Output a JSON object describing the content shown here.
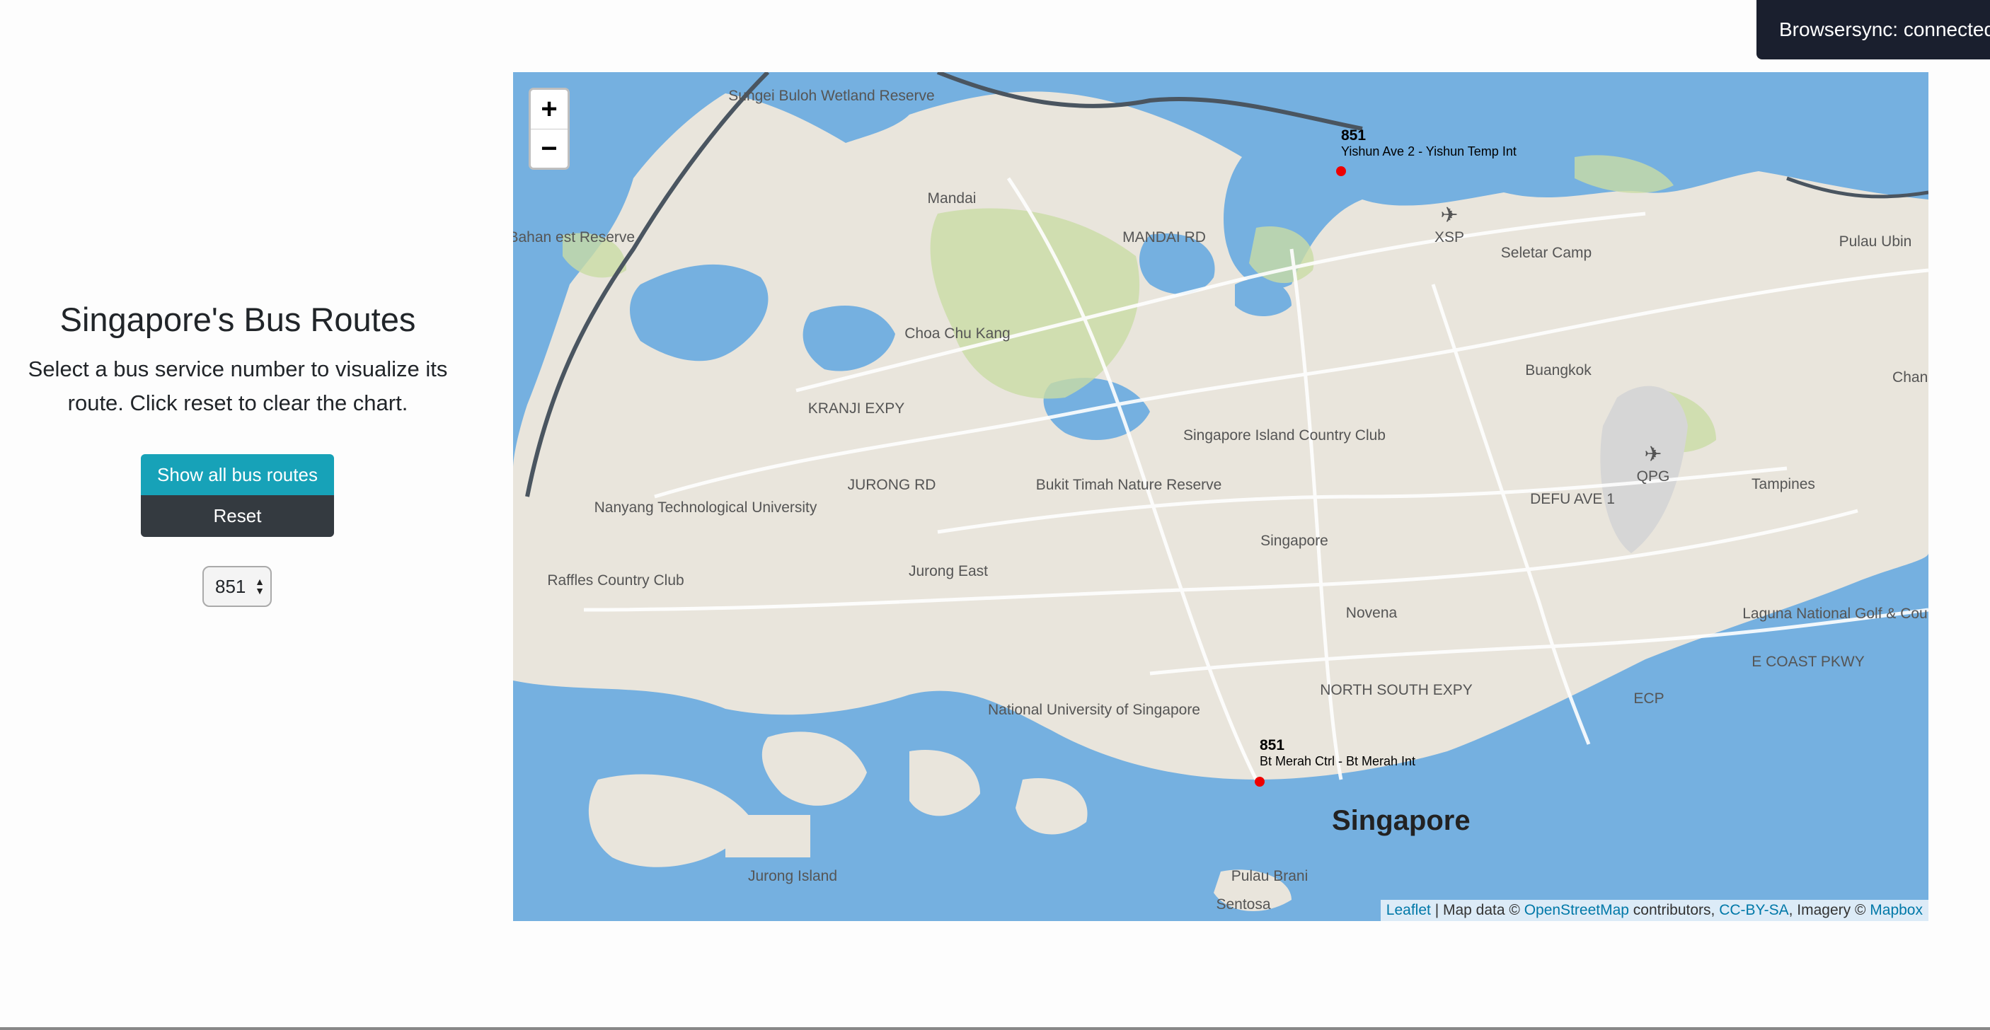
{
  "panel": {
    "title": "Singapore's Bus Routes",
    "description": "Select a bus service number to visualize its route. Click reset to clear the chart.",
    "show_all_label": "Show all bus routes",
    "reset_label": "Reset",
    "selected_service": "851"
  },
  "map": {
    "zoom_in": "+",
    "zoom_out": "−",
    "city_label": "Singapore",
    "place_labels": [
      "Sungei Buloh Wetland Reserve",
      "Mandai",
      "XSP",
      "Seletar Camp",
      "Pulau Ubin",
      "Choa Chu Kang",
      "Buangkok",
      "Singapore Island Country Club",
      "QPG",
      "Tampines",
      "Nanyang Technological University",
      "Bukit Timah Nature Reserve",
      "Jurong East",
      "Singapore",
      "Raffles Country Club",
      "Novena",
      "Laguna National Golf & Country Club",
      "National University of Singapore",
      "Jurong Island",
      "Pulau Brani",
      "Sentosa",
      "ECP",
      "MANDAI RD",
      "KRANJI EXPY",
      "JURONG RD",
      "NORTH SOUTH EXPY",
      "DEFU AVE 1",
      "E COAST PKWY",
      "ngai Bahan est Reserve",
      "Chang"
    ],
    "markers": [
      {
        "service": "851",
        "stop": "Yishun Ave 2 - Yishun Temp Int"
      },
      {
        "service": "851",
        "stop": "Bt Merah Ctrl - Bt Merah Int"
      }
    ],
    "attribution": {
      "leaflet": "Leaflet",
      "sep1": " | Map data © ",
      "osm": "OpenStreetMap",
      "sep2": " contributors, ",
      "license": "CC-BY-SA",
      "sep3": ", Imagery © ",
      "mapbox": "Mapbox"
    }
  },
  "browsersync": {
    "text": "Browsersync: connected"
  },
  "colors": {
    "water": "#75b0e0",
    "land": "#e9e5dc",
    "park": "#c9dca5",
    "show_button": "#17a2b8",
    "reset_button": "#343a40",
    "marker": "#e00000"
  }
}
